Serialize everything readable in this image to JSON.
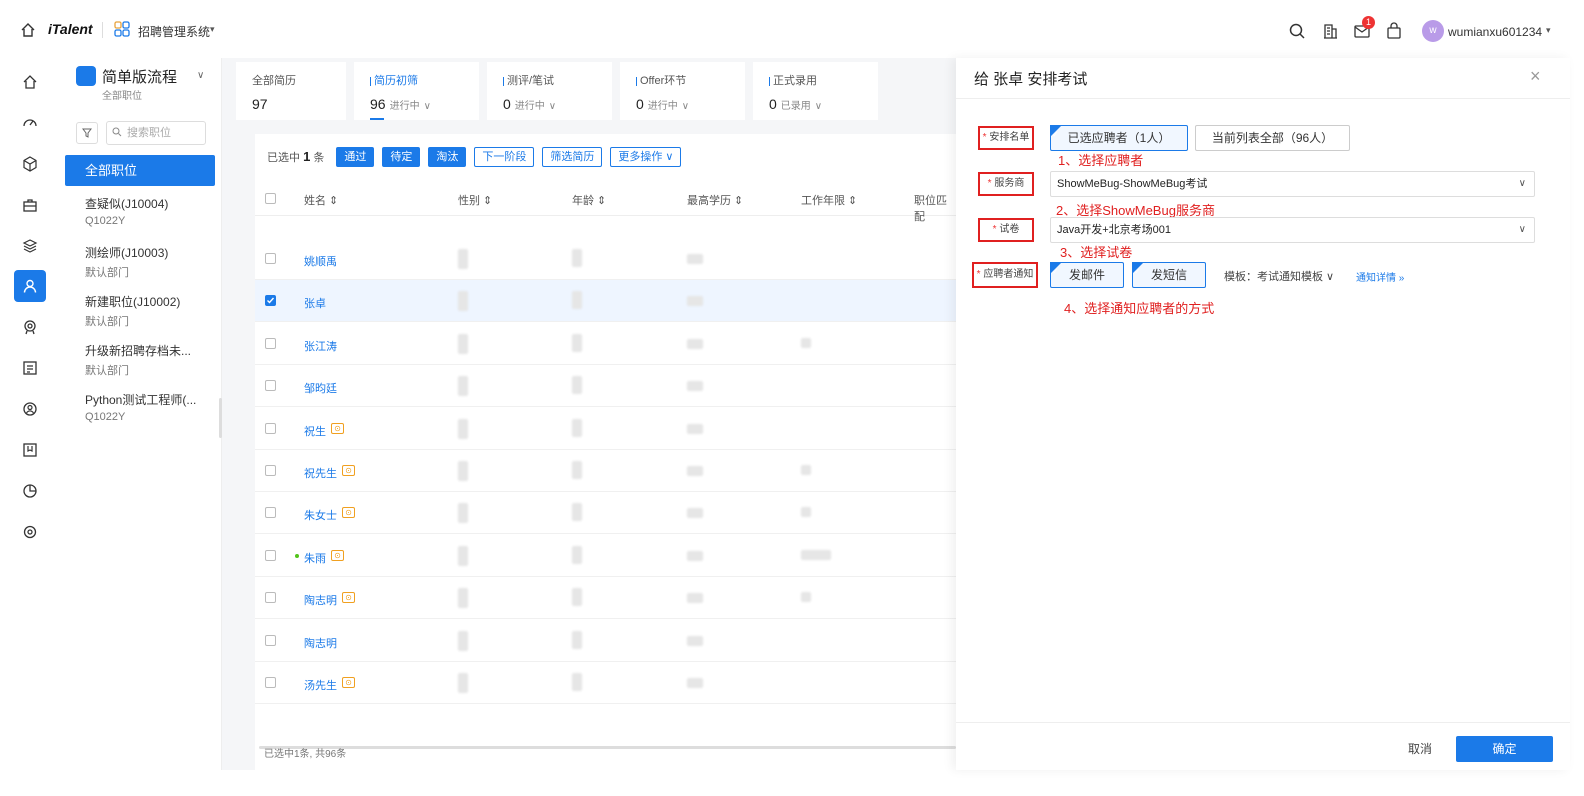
{
  "topbar": {
    "brand": "iTalent",
    "system_name": "招聘管理系统",
    "notification_count": "1",
    "avatar_letter": "w",
    "username": "wumianxu601234"
  },
  "sidebar": {
    "flow_title": "简单版流程",
    "flow_sub": "全部职位",
    "search_placeholder": "搜索职位",
    "all_positions": "全部职位",
    "positions": [
      {
        "name": "查疑似(J10004)",
        "dept": "Q1022Y"
      },
      {
        "name": "测绘师(J10003)",
        "dept": "默认部门"
      },
      {
        "name": "新建职位(J10002)",
        "dept": "默认部门"
      },
      {
        "name": "升级新招聘存档未...",
        "dept": "默认部门"
      },
      {
        "name": "Python测试工程师(...",
        "dept": "Q1022Y"
      }
    ]
  },
  "stages": [
    {
      "name": "全部简历",
      "count": "97",
      "state": ""
    },
    {
      "name": "简历初筛",
      "count": "96",
      "state": "进行中"
    },
    {
      "name": "测评/笔试",
      "count": "0",
      "state": "进行中"
    },
    {
      "name": "Offer环节",
      "count": "0",
      "state": "进行中"
    },
    {
      "name": "正式录用",
      "count": "0",
      "state": "已录用"
    }
  ],
  "toolbar": {
    "selected_prefix": "已选中",
    "selected_count": "1",
    "selected_suffix": "条",
    "pass": "通过",
    "pending": "待定",
    "eliminate": "淘汰",
    "next_stage": "下一阶段",
    "filter_resume": "筛选简历",
    "more_ops": "更多操作"
  },
  "table": {
    "headers": [
      "姓名",
      "性别",
      "年龄",
      "最高学历",
      "工作年限",
      "职位匹配"
    ],
    "rows": [
      {
        "name": "姚顺禹",
        "tag": false,
        "dot": false,
        "checked": false
      },
      {
        "name": "张卓",
        "tag": false,
        "dot": false,
        "checked": true
      },
      {
        "name": "张江涛",
        "tag": false,
        "dot": false,
        "checked": false
      },
      {
        "name": "邹昀廷",
        "tag": false,
        "dot": false,
        "checked": false
      },
      {
        "name": "祝生",
        "tag": true,
        "dot": false,
        "checked": false
      },
      {
        "name": "祝先生",
        "tag": true,
        "dot": false,
        "checked": false
      },
      {
        "name": "朱女士",
        "tag": true,
        "dot": false,
        "checked": false
      },
      {
        "name": "朱雨",
        "tag": true,
        "dot": true,
        "checked": false
      },
      {
        "name": "陶志明",
        "tag": true,
        "dot": false,
        "checked": false
      },
      {
        "name": "陶志明",
        "tag": false,
        "dot": false,
        "checked": false
      },
      {
        "name": "汤先生",
        "tag": true,
        "dot": false,
        "checked": false
      }
    ],
    "partial_cells": {
      "work_years_row3": "年",
      "work_years_row8": "以上",
      "work_years_row9": "年",
      "work_years_row7": "10年",
      "edu_row1": "科"
    },
    "footer": "已选中1条, 共96条"
  },
  "drawer": {
    "title": "给 张卓 安排考试",
    "close": "×",
    "fields": {
      "arrange_list_label": "安排名单",
      "supplier_label": "服务商",
      "paper_label": "试卷",
      "notify_label": "应聘者通知"
    },
    "arrange_options": [
      "已选应聘者（1人）",
      "当前列表全部（96人）"
    ],
    "supplier_value": "ShowMeBug-ShowMeBug考试",
    "paper_value": "Java开发+北京考场001",
    "notify_options": [
      "发邮件",
      "发短信"
    ],
    "template_label": "模板：考试通知模板",
    "notify_detail": "通知详情",
    "annotations": [
      "1、选择应聘者",
      "2、选择ShowMeBug服务商",
      "3、选择试卷",
      "4、选择通知应聘者的方式"
    ],
    "cancel": "取消",
    "confirm": "确定"
  },
  "colors": {
    "accent": "#1b7ae8",
    "annotation_red": "#e02020",
    "tag_orange": "#f0a020"
  }
}
